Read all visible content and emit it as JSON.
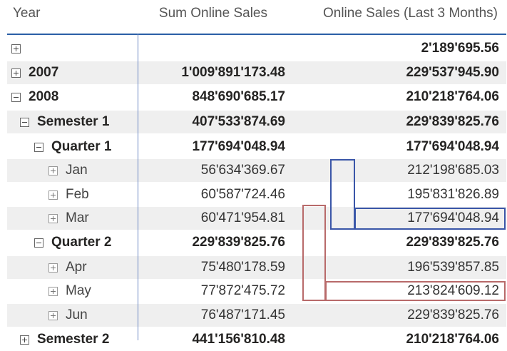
{
  "columns": {
    "year": "Year",
    "sum": "Sum Online Sales",
    "last3": "Online Sales (Last 3 Months)"
  },
  "rows": [
    {
      "label": "",
      "sum": "",
      "last3": "2'189'695.56",
      "level": 0,
      "icon": "expand-icon",
      "bold": true,
      "shaded": false
    },
    {
      "label": "2007",
      "sum": "1'009'891'173.48",
      "last3": "229'537'945.90",
      "level": 0,
      "icon": "expand-icon",
      "bold": true,
      "shaded": true
    },
    {
      "label": "2008",
      "sum": "848'690'685.17",
      "last3": "210'218'764.06",
      "level": 0,
      "icon": "collapse-icon",
      "bold": true,
      "shaded": false
    },
    {
      "label": "Semester 1",
      "sum": "407'533'874.69",
      "last3": "229'839'825.76",
      "level": 1,
      "icon": "collapse-icon",
      "bold": true,
      "shaded": true
    },
    {
      "label": "Quarter 1",
      "sum": "177'694'048.94",
      "last3": "177'694'048.94",
      "level": 2,
      "icon": "collapse-icon",
      "bold": true,
      "shaded": false
    },
    {
      "label": "Jan",
      "sum": "56'634'369.67",
      "last3": "212'198'685.03",
      "level": 3,
      "icon": "expand-icon",
      "bold": false,
      "shaded": true
    },
    {
      "label": "Feb",
      "sum": "60'587'724.46",
      "last3": "195'831'826.89",
      "level": 3,
      "icon": "expand-icon",
      "bold": false,
      "shaded": false
    },
    {
      "label": "Mar",
      "sum": "60'471'954.81",
      "last3": "177'694'048.94",
      "level": 3,
      "icon": "expand-icon",
      "bold": false,
      "shaded": true
    },
    {
      "label": "Quarter 2",
      "sum": "229'839'825.76",
      "last3": "229'839'825.76",
      "level": 2,
      "icon": "collapse-icon",
      "bold": true,
      "shaded": false
    },
    {
      "label": "Apr",
      "sum": "75'480'178.59",
      "last3": "196'539'857.85",
      "level": 3,
      "icon": "expand-icon",
      "bold": false,
      "shaded": true
    },
    {
      "label": "May",
      "sum": "77'872'475.72",
      "last3": "213'824'609.12",
      "level": 3,
      "icon": "expand-icon",
      "bold": false,
      "shaded": false
    },
    {
      "label": "Jun",
      "sum": "76'487'171.45",
      "last3": "229'839'825.76",
      "level": 3,
      "icon": "expand-icon",
      "bold": false,
      "shaded": true
    },
    {
      "label": "Semester 2",
      "sum": "441'156'810.48",
      "last3": "210'218'764.06",
      "level": 1,
      "icon": "expand-icon",
      "bold": true,
      "shaded": false
    }
  ],
  "highlight_colors": {
    "blue": "#3a56a8",
    "red": "#b86a6a"
  }
}
